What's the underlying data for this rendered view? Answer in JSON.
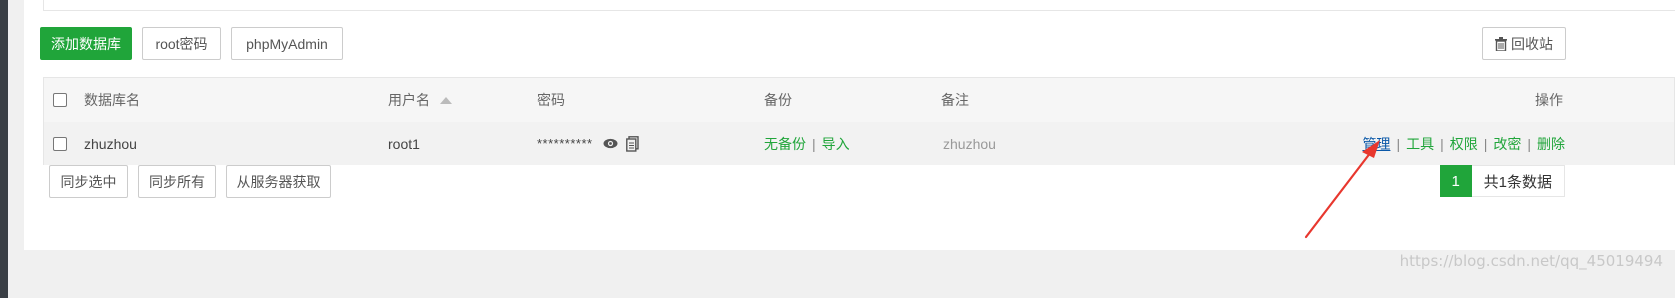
{
  "toolbar": {
    "add_db_label": "添加数据库",
    "root_pwd_label": "root密码",
    "phpmyadmin_label": "phpMyAdmin",
    "recycle_label": "回收站"
  },
  "table": {
    "headers": {
      "name": "数据库名",
      "user": "用户名",
      "password": "密码",
      "backup": "备份",
      "note": "备注",
      "actions": "操作"
    },
    "rows": [
      {
        "name": "zhuzhou",
        "user": "root1",
        "password": "**********",
        "backup_status": "无备份",
        "import": "导入",
        "note": "zhuzhou",
        "actions": [
          "管理",
          "工具",
          "权限",
          "改密",
          "删除"
        ]
      }
    ]
  },
  "footer": {
    "sync_selected": "同步选中",
    "sync_all": "同步所有",
    "fetch_from_server": "从服务器获取"
  },
  "pagination": {
    "current_page": "1",
    "total_text": "共1条数据"
  },
  "watermark": "https://blog.csdn.net/qq_45019494",
  "colors": {
    "accent": "#20a53a",
    "link_blue": "#0a58a8",
    "arrow": "#e8372e"
  },
  "icons": [
    "eye-icon",
    "copy-icon",
    "trash-icon",
    "sort-up-icon",
    "annotation-arrow"
  ]
}
